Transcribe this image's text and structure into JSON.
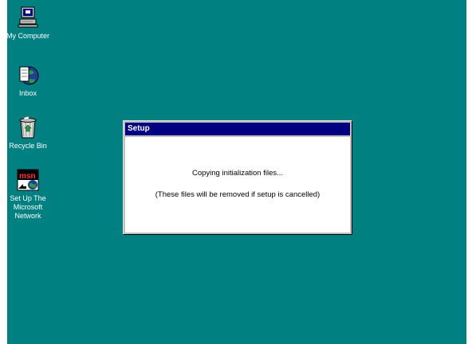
{
  "desktop": {
    "background_color": "#008080",
    "icons": [
      {
        "label": "My Computer",
        "icon": "my-computer-icon"
      },
      {
        "label": "Inbox",
        "icon": "inbox-icon"
      },
      {
        "label": "Recycle Bin",
        "icon": "recycle-bin-icon"
      },
      {
        "label": "Set Up The Microsoft Network",
        "icon": "msn-icon",
        "badge": "msn"
      }
    ]
  },
  "dialog": {
    "title": "Setup",
    "title_color": "#000080",
    "message": "Copying initialization files...",
    "note": "(These files will be removed if setup is cancelled)"
  }
}
